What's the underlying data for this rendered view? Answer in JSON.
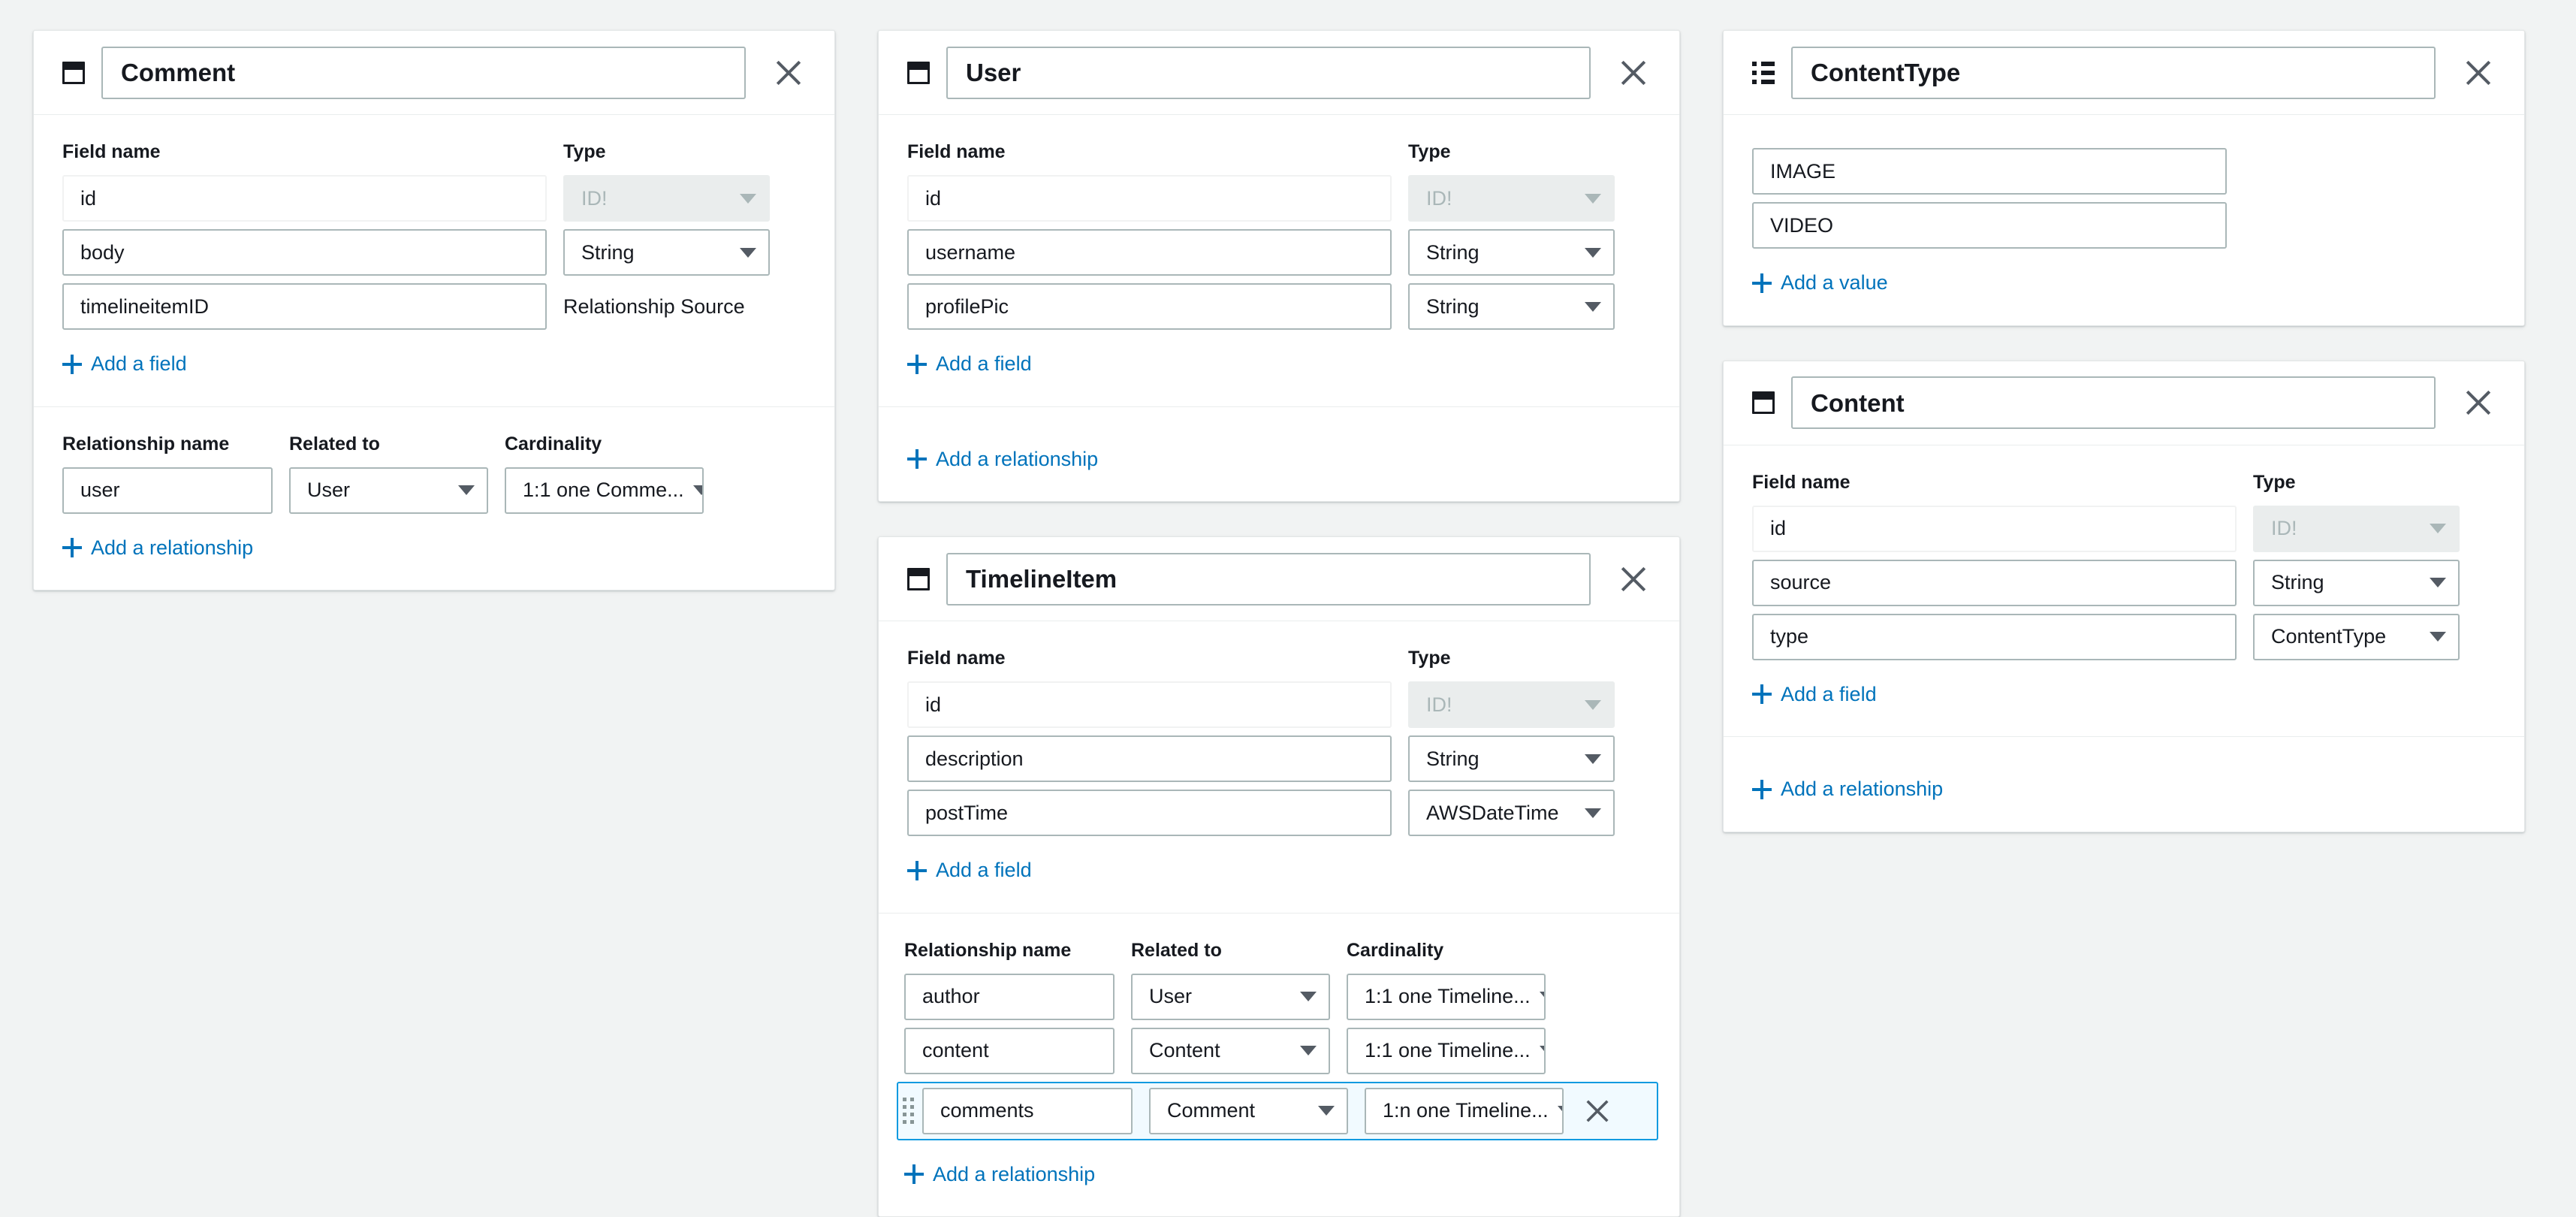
{
  "labels": {
    "field_name": "Field name",
    "type": "Type",
    "relationship_name": "Relationship name",
    "related_to": "Related to",
    "cardinality": "Cardinality",
    "add_field": "Add a field",
    "add_relationship": "Add a relationship",
    "add_value": "Add a value",
    "relationship_source": "Relationship Source"
  },
  "colors": {
    "accent_link": "#0073bb",
    "highlight_border": "#0f9ae0",
    "highlight_bg": "#f1faff",
    "input_border": "#aab7b8",
    "canvas_bg": "#f1f3f3",
    "card_bg": "#ffffff",
    "disabled_bg": "#eaeded",
    "disabled_text": "#aab7b8"
  },
  "icons": {
    "model": "model-icon",
    "enum": "enum-icon",
    "close": "close-icon",
    "drag": "drag-handle-icon",
    "plus": "plus-icon",
    "caret": "chevron-down-icon"
  },
  "cards": [
    {
      "id": "comment",
      "kind": "model",
      "title": "Comment",
      "fields": [
        {
          "name": "id",
          "type": "ID!",
          "type_kind": "select",
          "disabled": true
        },
        {
          "name": "body",
          "type": "String",
          "type_kind": "select",
          "disabled": false
        },
        {
          "name": "timelineitemID",
          "type": "Relationship Source",
          "type_kind": "static",
          "disabled": false
        }
      ],
      "relationships": [
        {
          "name": "user",
          "related_to": "User",
          "cardinality": "1:1 one Comme..."
        }
      ],
      "has_relationship_section": true
    },
    {
      "id": "user",
      "kind": "model",
      "title": "User",
      "fields": [
        {
          "name": "id",
          "type": "ID!",
          "type_kind": "select",
          "disabled": true
        },
        {
          "name": "username",
          "type": "String",
          "type_kind": "select",
          "disabled": false
        },
        {
          "name": "profilePic",
          "type": "String",
          "type_kind": "select",
          "disabled": false
        }
      ],
      "relationships": [],
      "has_relationship_section": true
    },
    {
      "id": "timelineitem",
      "kind": "model",
      "title": "TimelineItem",
      "fields": [
        {
          "name": "id",
          "type": "ID!",
          "type_kind": "select",
          "disabled": true
        },
        {
          "name": "description",
          "type": "String",
          "type_kind": "select",
          "disabled": false
        },
        {
          "name": "postTime",
          "type": "AWSDateTime",
          "type_kind": "select",
          "disabled": false
        }
      ],
      "relationships": [
        {
          "name": "author",
          "related_to": "User",
          "cardinality": "1:1 one Timeline...",
          "selected": false
        },
        {
          "name": "content",
          "related_to": "Content",
          "cardinality": "1:1 one Timeline...",
          "selected": false
        },
        {
          "name": "comments",
          "related_to": "Comment",
          "cardinality": "1:n one Timeline...",
          "selected": true
        }
      ],
      "has_relationship_section": true,
      "rel_indent": true
    },
    {
      "id": "contenttype",
      "kind": "enum",
      "title": "ContentType",
      "values": [
        "IMAGE",
        "VIDEO"
      ]
    },
    {
      "id": "content",
      "kind": "model",
      "title": "Content",
      "fields": [
        {
          "name": "id",
          "type": "ID!",
          "type_kind": "select",
          "disabled": true
        },
        {
          "name": "source",
          "type": "String",
          "type_kind": "select",
          "disabled": false
        },
        {
          "name": "type",
          "type": "ContentType",
          "type_kind": "select",
          "disabled": false
        }
      ],
      "relationships": [],
      "has_relationship_section": true
    }
  ]
}
